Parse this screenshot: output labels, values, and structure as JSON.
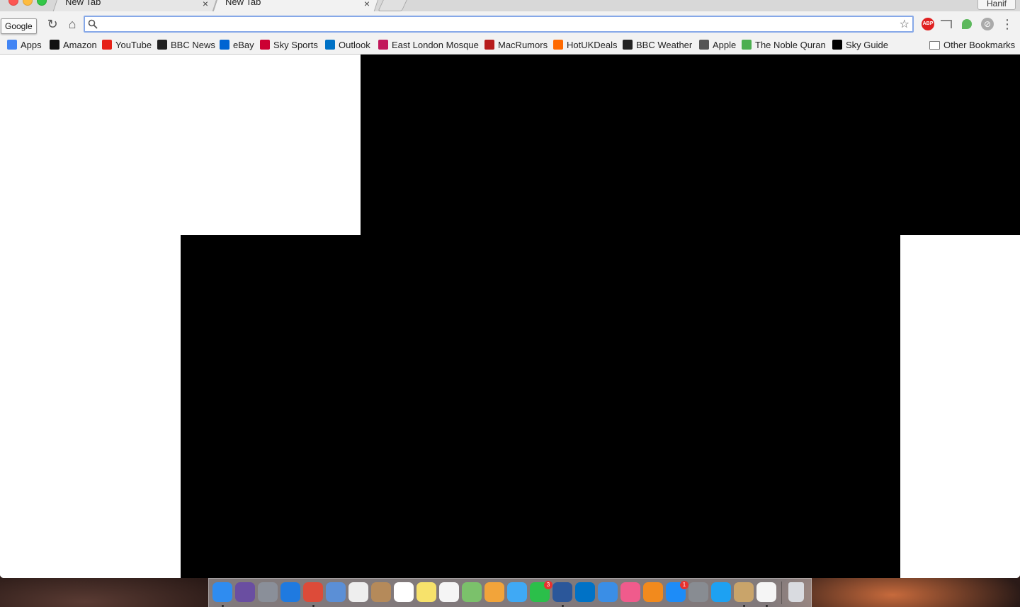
{
  "window": {
    "tabs": [
      {
        "title": "New Tab",
        "close": "×"
      },
      {
        "title": "New Tab",
        "close": "×"
      }
    ],
    "profile": "Hanif"
  },
  "toolbar": {
    "tooltip": "Google",
    "reload": "↻",
    "home": "⌂",
    "omnibox": {
      "value": "",
      "placeholder": ""
    },
    "search_icon": "search-icon",
    "star": "☆",
    "menu": "⋮",
    "extensions": {
      "adblock": "ABP",
      "grey": "⊘"
    }
  },
  "bookmarks": {
    "items": [
      {
        "label": "Apps",
        "icon": "apps-grid-icon",
        "color": "#4285f4"
      },
      {
        "label": "Amazon",
        "icon": "amazon-icon",
        "color": "#111111"
      },
      {
        "label": "YouTube",
        "icon": "youtube-icon",
        "color": "#e62117"
      },
      {
        "label": "BBC News",
        "icon": "bbc-icon",
        "color": "#222222"
      },
      {
        "label": "eBay",
        "icon": "ebay-icon",
        "color": "#0064d2"
      },
      {
        "label": "Sky Sports",
        "icon": "sky-sports-icon",
        "color": "#cc0033"
      },
      {
        "label": "Outlook",
        "icon": "outlook-icon",
        "color": "#0072c6"
      },
      {
        "label": "East London Mosque",
        "icon": "mosque-icon",
        "color": "#c2185b"
      },
      {
        "label": "MacRumors",
        "icon": "macrumors-icon",
        "color": "#b71c1c"
      },
      {
        "label": "HotUKDeals",
        "icon": "hotukdeals-icon",
        "color": "#ff6a00"
      },
      {
        "label": "BBC Weather",
        "icon": "bbc-icon",
        "color": "#222222"
      },
      {
        "label": "Apple",
        "icon": "apple-icon",
        "color": "#555555"
      },
      {
        "label": "The Noble Quran",
        "icon": "quran-icon",
        "color": "#4caf50"
      },
      {
        "label": "Sky Guide",
        "icon": "sky-icon",
        "color": "#000000"
      }
    ],
    "other": "Other Bookmarks"
  },
  "dock": {
    "apps": [
      {
        "name": "finder-icon",
        "color": "#2f8cf0",
        "running": true
      },
      {
        "name": "siri-icon",
        "color": "#6a4ea1",
        "running": false
      },
      {
        "name": "launchpad-icon",
        "color": "#8a8f99",
        "running": false
      },
      {
        "name": "safari-icon",
        "color": "#1f7ae0",
        "running": false
      },
      {
        "name": "chrome-icon",
        "color": "#dd4b39",
        "running": true
      },
      {
        "name": "preview-icon",
        "color": "#5b8fd6",
        "running": false
      },
      {
        "name": "launcher-grid-icon",
        "color": "#eeeeee",
        "running": false
      },
      {
        "name": "contacts-icon",
        "color": "#b58a5a",
        "running": false
      },
      {
        "name": "calendar-icon",
        "color": "#ffffff",
        "running": false
      },
      {
        "name": "notes-icon",
        "color": "#f7e26b",
        "running": false
      },
      {
        "name": "reminders-icon",
        "color": "#f5f5f5",
        "running": false
      },
      {
        "name": "maps-icon",
        "color": "#7bc16b",
        "running": false
      },
      {
        "name": "photos-icon",
        "color": "#f2a43a",
        "running": false
      },
      {
        "name": "messages-icon",
        "color": "#3fa9f5",
        "running": false
      },
      {
        "name": "facetime-icon",
        "color": "#2bbf4a",
        "running": false,
        "badge": "3"
      },
      {
        "name": "word-icon",
        "color": "#2b579a",
        "running": true
      },
      {
        "name": "outlook-icon",
        "color": "#0072c6",
        "running": false
      },
      {
        "name": "xcode-icon",
        "color": "#3a8ee6",
        "running": false
      },
      {
        "name": "itunes-icon",
        "color": "#f05b8c",
        "running": false
      },
      {
        "name": "ibooks-icon",
        "color": "#f28a1d",
        "running": false
      },
      {
        "name": "app-store-icon",
        "color": "#1d8cf8",
        "running": false,
        "badge": "1"
      },
      {
        "name": "system-preferences-icon",
        "color": "#888c92",
        "running": false
      },
      {
        "name": "twitter-icon",
        "color": "#1da1f2",
        "running": false
      },
      {
        "name": "archive-utility-icon",
        "color": "#c9a46a",
        "running": true
      },
      {
        "name": "textedit-icon",
        "color": "#f5f5f5",
        "running": true
      }
    ],
    "trash": {
      "name": "trash-icon",
      "color": "#d9dbe0"
    }
  }
}
